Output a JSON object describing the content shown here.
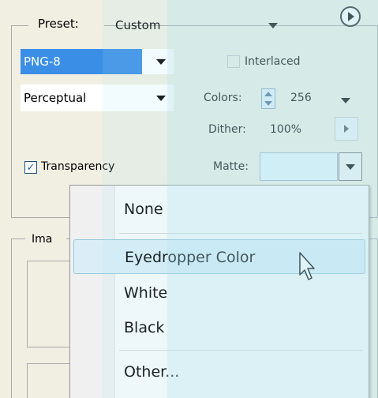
{
  "preset": {
    "label": "Preset:",
    "value": "Custom"
  },
  "format": {
    "value": "PNG-8"
  },
  "reduction": {
    "value": "Perceptual"
  },
  "interlaced": {
    "label": "Interlaced",
    "checked": false
  },
  "colors": {
    "label": "Colors:",
    "value": "256"
  },
  "dither": {
    "label": "Dither:",
    "value": "100%"
  },
  "transparency": {
    "label": "Transparency",
    "checked": true
  },
  "matte": {
    "label": "Matte:",
    "value": ""
  },
  "image_group": {
    "label": "Ima"
  },
  "matte_menu": {
    "items": [
      {
        "label": "None"
      },
      {
        "label": "Eyedropper Color",
        "highlighted": true
      },
      {
        "label": "White"
      },
      {
        "label": "Black"
      },
      {
        "label": "Other..."
      }
    ]
  },
  "colors_palette": {
    "accent": "#3a8ee6",
    "menu_hover": "#dbeef7",
    "overlay": "#aae1f0"
  }
}
